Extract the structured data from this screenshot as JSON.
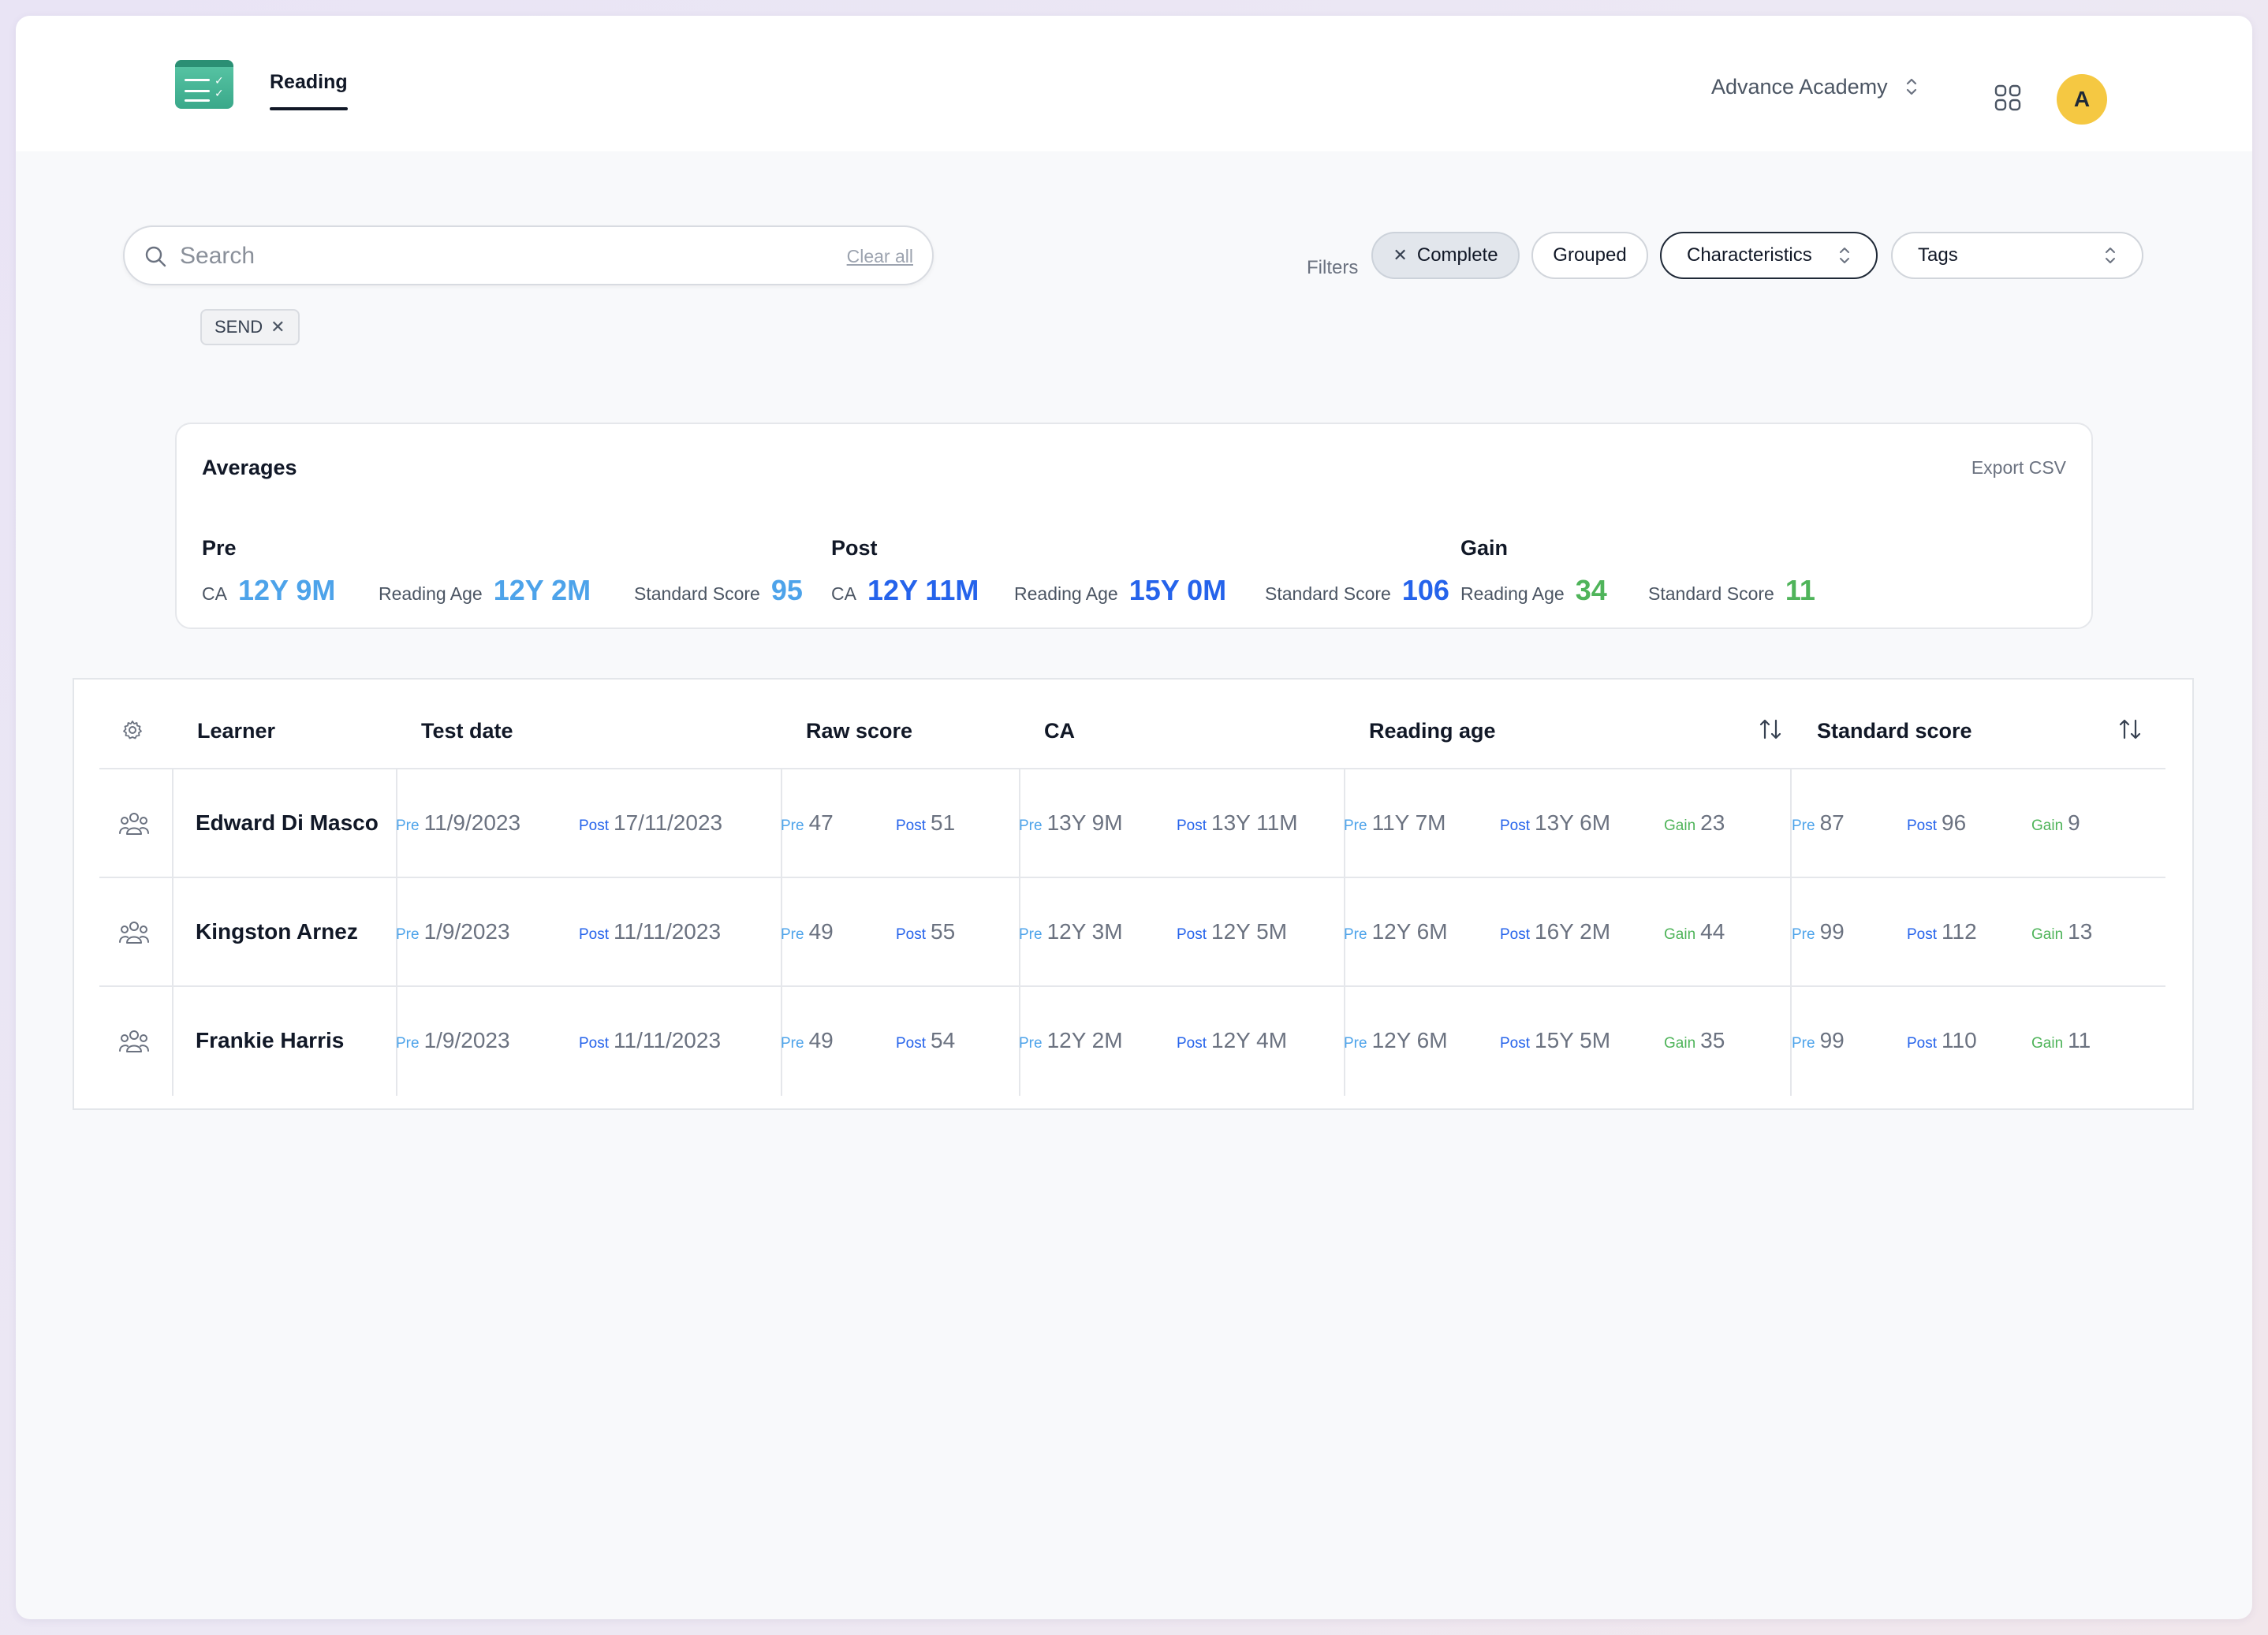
{
  "header": {
    "app_tab": "Reading",
    "org_name": "Advance Academy",
    "avatar_initial": "A"
  },
  "search": {
    "placeholder": "Search",
    "value": "",
    "clear_all": "Clear all"
  },
  "active_chips": [
    "SEND"
  ],
  "filters": {
    "label": "Filters",
    "complete": "Complete",
    "grouped": "Grouped",
    "characteristics": "Characteristics",
    "tags": "Tags"
  },
  "averages": {
    "title": "Averages",
    "export": "Export CSV",
    "pre": {
      "title": "Pre",
      "ca_label": "CA",
      "ca": "12Y 9M",
      "ra_label": "Reading Age",
      "ra": "12Y 2M",
      "ss_label": "Standard Score",
      "ss": "95"
    },
    "post": {
      "title": "Post",
      "ca_label": "CA",
      "ca": "12Y 11M",
      "ra_label": "Reading Age",
      "ra": "15Y 0M",
      "ss_label": "Standard Score",
      "ss": "106"
    },
    "gain": {
      "title": "Gain",
      "ra_label": "Reading Age",
      "ra": "34",
      "ss_label": "Standard Score",
      "ss": "11"
    }
  },
  "table": {
    "columns": {
      "learner": "Learner",
      "test_date": "Test date",
      "raw_score": "Raw score",
      "ca": "CA",
      "reading_age": "Reading age",
      "standard_score": "Standard score"
    },
    "tags": {
      "pre": "Pre",
      "post": "Post",
      "gain": "Gain"
    },
    "rows": [
      {
        "learner": "Edward Di Masco",
        "date_pre": "11/9/2023",
        "date_post": "17/11/2023",
        "raw_pre": "47",
        "raw_post": "51",
        "ca_pre": "13Y 9M",
        "ca_post": "13Y 11M",
        "ra_pre": "11Y 7M",
        "ra_post": "13Y 6M",
        "ra_gain": "23",
        "ss_pre": "87",
        "ss_post": "96",
        "ss_gain": "9"
      },
      {
        "learner": "Kingston Arnez",
        "date_pre": "1/9/2023",
        "date_post": "11/11/2023",
        "raw_pre": "49",
        "raw_post": "55",
        "ca_pre": "12Y 3M",
        "ca_post": "12Y 5M",
        "ra_pre": "12Y 6M",
        "ra_post": "16Y 2M",
        "ra_gain": "44",
        "ss_pre": "99",
        "ss_post": "112",
        "ss_gain": "13"
      },
      {
        "learner": "Frankie Harris",
        "date_pre": "1/9/2023",
        "date_post": "11/11/2023",
        "raw_pre": "49",
        "raw_post": "54",
        "ca_pre": "12Y 2M",
        "ca_post": "12Y 4M",
        "ra_pre": "12Y 6M",
        "ra_post": "15Y 5M",
        "ra_gain": "35",
        "ss_pre": "99",
        "ss_post": "110",
        "ss_gain": "11"
      }
    ]
  },
  "colors": {
    "pre": "#4da3ea",
    "post": "#2563eb",
    "gain": "#4fb45a",
    "avatar": "#f5c842",
    "logo": "#3aa88a"
  }
}
